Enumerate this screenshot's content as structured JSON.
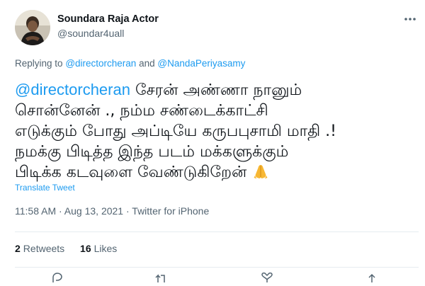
{
  "author": {
    "name": "Soundara Raja Actor",
    "handle": "@soundar4uall"
  },
  "reply": {
    "prefix": "Replying to",
    "user1": "@directorcheran",
    "conjunction": "and",
    "user2": "@NandaPeriyasamy"
  },
  "tweet": {
    "mention": "@directorcheran",
    "line1_text": " சேரன் அண்ணா நானும்",
    "line2": "சொன்னேன் ., நம்ம சண்டைக்காட்சி",
    "line3": "எடுக்கும் போது அப்டியே கருபபுசாமி மாதி .!",
    "line4": "நமக்கு பிடித்த இந்த படம் மக்களுக்கும்",
    "line5": "பிடிக்க கடவுளை வேண்டுகிறேன்",
    "emoji": "folded-hands-icon"
  },
  "translate_label": "Translate Tweet",
  "meta": {
    "time": "11:58 AM",
    "separator": " · ",
    "date": "Aug 13, 2021",
    "app": "Twitter for iPhone"
  },
  "stats": {
    "retweets_count": "2",
    "retweets_label": "Retweets",
    "likes_count": "16",
    "likes_label": "Likes"
  },
  "colors": {
    "accent": "#1d9bf0",
    "text": "#0f1419",
    "secondary": "#536471",
    "divider": "#e6ecf0",
    "emoji": "#f7b733"
  },
  "icons": [
    "avatar",
    "more-icon",
    "folded-hands-icon",
    "reply-icon",
    "retweet-icon",
    "like-icon",
    "share-icon"
  ]
}
